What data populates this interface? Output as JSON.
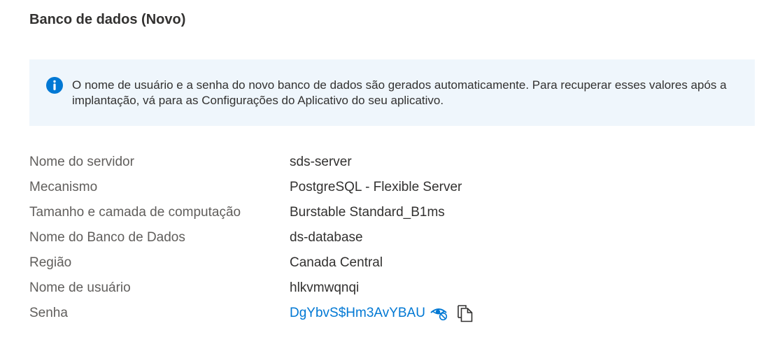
{
  "section": {
    "title": "Banco de dados (Novo)"
  },
  "info": {
    "icon": "info-icon",
    "text": "O nome de usuário e a senha do novo banco de dados são gerados automaticamente. Para recuperar esses valores após a implantação, vá para as Configurações do Aplicativo do seu aplicativo."
  },
  "details": [
    {
      "label": "Nome do servidor",
      "value": "sds-server"
    },
    {
      "label": "Mecanismo",
      "value": "PostgreSQL - Flexible Server"
    },
    {
      "label": "Tamanho e camada de computação",
      "value": "Burstable Standard_B1ms"
    },
    {
      "label": "Nome do Banco de Dados",
      "value": "ds-database"
    },
    {
      "label": "Região",
      "value": "Canada Central"
    },
    {
      "label": "Nome de usuário",
      "value": "hlkvmwqnqi"
    },
    {
      "label": "Senha",
      "value": "DgYbvS$Hm3AvYBAU"
    }
  ],
  "password_actions": {
    "toggle_icon": "eye-hide-icon",
    "copy_icon": "copy-icon"
  },
  "colors": {
    "info_background": "#eff6fc",
    "info_icon": "#0078d4",
    "link": "#0078d4",
    "label": "#605e5c",
    "text": "#323130"
  }
}
